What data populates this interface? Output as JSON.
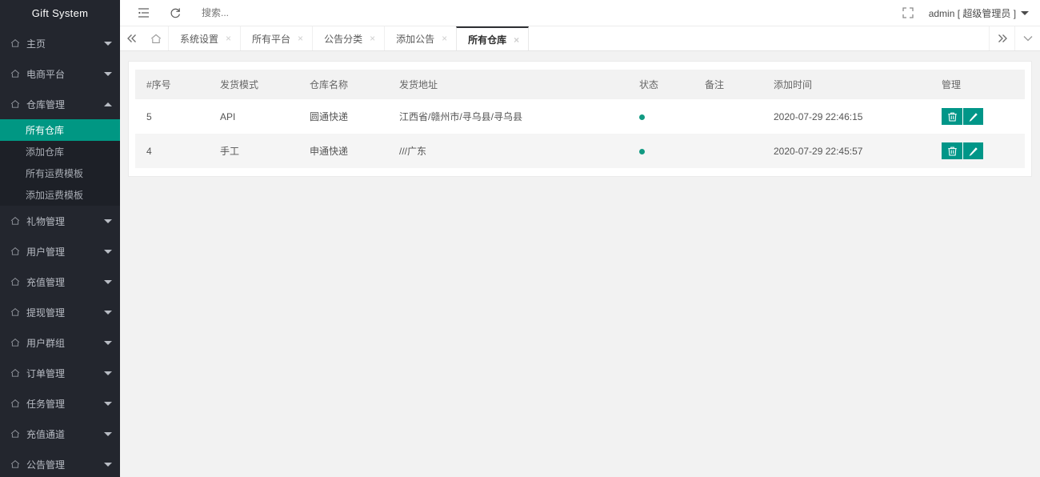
{
  "sidebar": {
    "brand": "Gift System",
    "items": [
      {
        "label": "主页",
        "icon": "house-icon",
        "expanded": false
      },
      {
        "label": "电商平台",
        "icon": "house-icon",
        "expanded": false
      },
      {
        "label": "仓库管理",
        "icon": "house-icon",
        "expanded": true,
        "children": [
          {
            "label": "所有仓库",
            "active": true
          },
          {
            "label": "添加仓库",
            "active": false
          },
          {
            "label": "所有运费模板",
            "active": false
          },
          {
            "label": "添加运费模板",
            "active": false
          }
        ]
      },
      {
        "label": "礼物管理",
        "icon": "house-icon",
        "expanded": false
      },
      {
        "label": "用户管理",
        "icon": "house-icon",
        "expanded": false
      },
      {
        "label": "充值管理",
        "icon": "house-icon",
        "expanded": false
      },
      {
        "label": "提现管理",
        "icon": "house-icon",
        "expanded": false
      },
      {
        "label": "用户群组",
        "icon": "house-icon",
        "expanded": false
      },
      {
        "label": "订单管理",
        "icon": "house-icon",
        "expanded": false
      },
      {
        "label": "任务管理",
        "icon": "house-icon",
        "expanded": false
      },
      {
        "label": "充值通道",
        "icon": "house-icon",
        "expanded": false
      },
      {
        "label": "公告管理",
        "icon": "house-icon",
        "expanded": false
      }
    ]
  },
  "topbar": {
    "menu_icon": "list-menu-icon",
    "refresh_icon": "refresh-icon",
    "search_placeholder": "搜索...",
    "search_value": "",
    "fullscreen_icon": "fullscreen-icon",
    "user_label": "admin [ 超级管理员 ]",
    "user_caret_icon": "chevron-down-icon"
  },
  "tabbar": {
    "collapse_icon": "double-chevron-left-icon",
    "home_icon": "home-icon",
    "tabs": [
      {
        "label": "系统设置",
        "active": false,
        "close": "×"
      },
      {
        "label": "所有平台",
        "active": false,
        "close": "×"
      },
      {
        "label": "公告分类",
        "active": false,
        "close": "×"
      },
      {
        "label": "添加公告",
        "active": false,
        "close": "×"
      },
      {
        "label": "所有仓库",
        "active": true,
        "close": "×"
      }
    ],
    "scroll_right_icon": "double-chevron-right-icon",
    "dropdown_icon": "chevron-down-icon"
  },
  "table": {
    "columns": [
      "#序号",
      "发货模式",
      "仓库名称",
      "发货地址",
      "状态",
      "备注",
      "添加时间",
      "管理"
    ],
    "rows": [
      {
        "index": "5",
        "mode": "API",
        "warehouse": "圆通快递",
        "address": "江西省/赣州市/寻乌县/寻乌县",
        "status": "active",
        "remark": "",
        "created_at": "2020-07-29 22:46:15",
        "actions": [
          {
            "name": "delete-button",
            "icon": "trash-icon"
          },
          {
            "name": "edit-button",
            "icon": "pencil-icon"
          }
        ]
      },
      {
        "index": "4",
        "mode": "手工",
        "warehouse": "申通快递",
        "address": "///广东",
        "status": "active",
        "remark": "",
        "created_at": "2020-07-29 22:45:57",
        "actions": [
          {
            "name": "delete-button",
            "icon": "trash-icon"
          },
          {
            "name": "edit-button",
            "icon": "pencil-icon"
          }
        ]
      }
    ]
  },
  "colors": {
    "accent": "#009688",
    "sidebar_bg": "#23262E",
    "submenu_bg": "#1D2027",
    "active_item": "#009783",
    "content_bg": "#f2f2f2",
    "status_dot": "#119a82"
  }
}
